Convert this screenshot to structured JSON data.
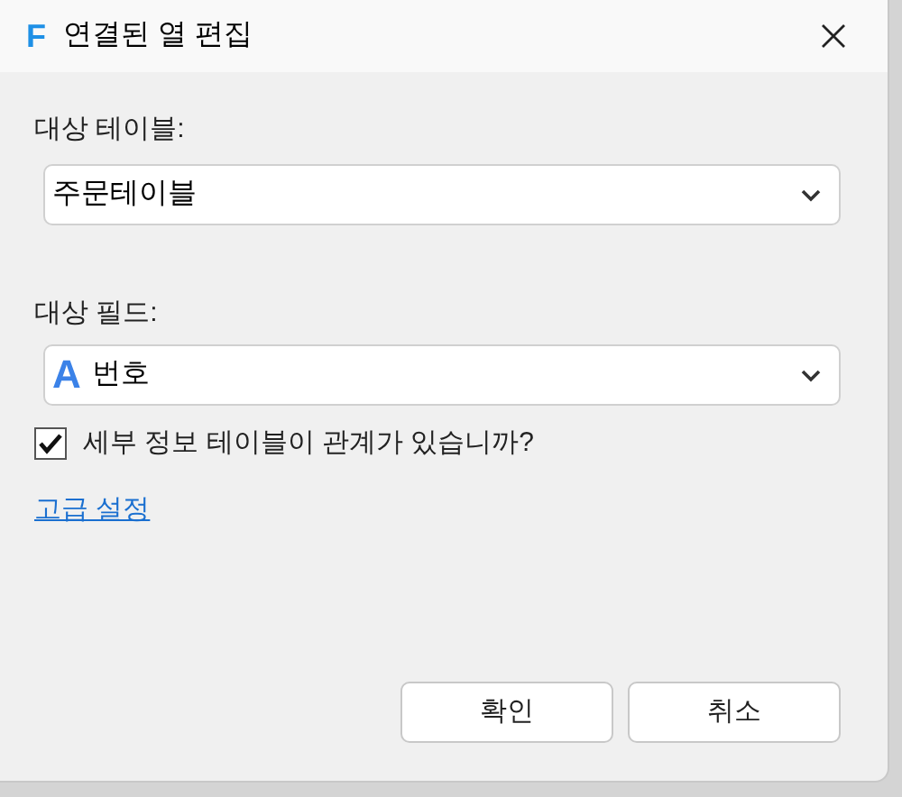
{
  "window": {
    "title": "연결된 열 편집",
    "app_icon": "F"
  },
  "target_table": {
    "label": "대상 테이블:",
    "value": "주문테이블"
  },
  "target_field": {
    "label": "대상 필드:",
    "type_icon": "A",
    "value": "번호"
  },
  "detail_table_checkbox": {
    "label": "세부 정보 테이블이 관계가 있습니까?",
    "checked": true
  },
  "advanced_link": "고급 설정",
  "buttons": [
    "확인",
    "취소"
  ]
}
